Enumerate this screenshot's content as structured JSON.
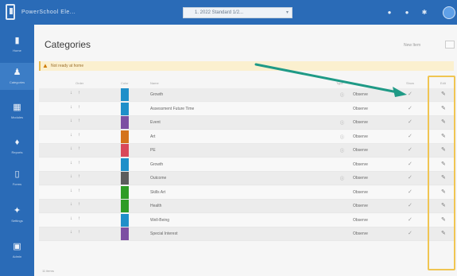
{
  "app": {
    "brand_name": "PowerSchool Ele..."
  },
  "topbar": {
    "env_select": "1. 2022 Standard 1/2...",
    "icons": [
      "bell-icon",
      "help-icon",
      "gear-icon"
    ]
  },
  "sidebar": {
    "items": [
      {
        "icon": "home-icon",
        "label": "Home"
      },
      {
        "icon": "categories-icon",
        "label": "Categories",
        "active": true
      },
      {
        "icon": "grid-icon",
        "label": "Modules"
      },
      {
        "icon": "reports-icon",
        "label": "Reports"
      },
      {
        "icon": "document-icon",
        "label": "Forms"
      },
      {
        "icon": "settings-icon",
        "label": "Settings"
      },
      {
        "icon": "admin-icon",
        "label": "Admin"
      }
    ]
  },
  "page": {
    "title": "Categories",
    "header_action": "New Item",
    "warning": "Not ready at home"
  },
  "table": {
    "headers": {
      "order": "Order",
      "color": "Color",
      "name": "Name",
      "type": "Type",
      "show": "Show",
      "edit": "Edit"
    },
    "rows": [
      {
        "name": "Growth",
        "info": true,
        "type": "Observe",
        "color": "#1f8fc9"
      },
      {
        "name": "Assessment Future Time",
        "info": false,
        "type": "Observe",
        "color": "#1f8fc9"
      },
      {
        "name": "Event",
        "info": true,
        "type": "Observe",
        "color": "#7c4fa3"
      },
      {
        "name": "Art",
        "info": true,
        "type": "Observe",
        "color": "#d4731c"
      },
      {
        "name": "PE",
        "info": true,
        "type": "Observe",
        "color": "#d9485a"
      },
      {
        "name": "Growth",
        "info": false,
        "type": "Observe",
        "color": "#1f8fc9"
      },
      {
        "name": "Outcome",
        "info": true,
        "type": "Observe",
        "color": "#5c5c5c"
      },
      {
        "name": "Skills Art",
        "info": false,
        "type": "Observe",
        "color": "#2e9c25"
      },
      {
        "name": "Health",
        "info": false,
        "type": "Observe",
        "color": "#2e9c25"
      },
      {
        "name": "Well-Being",
        "info": false,
        "type": "Observe",
        "color": "#1f8fc9"
      },
      {
        "name": "Special Interest",
        "info": false,
        "type": "Observe",
        "color": "#7c4fa3"
      }
    ],
    "footer": "11 items"
  },
  "colors": {
    "topbar": "#2a6bb7",
    "arrow": "#1f9a86",
    "highlight": "#f0c552"
  }
}
